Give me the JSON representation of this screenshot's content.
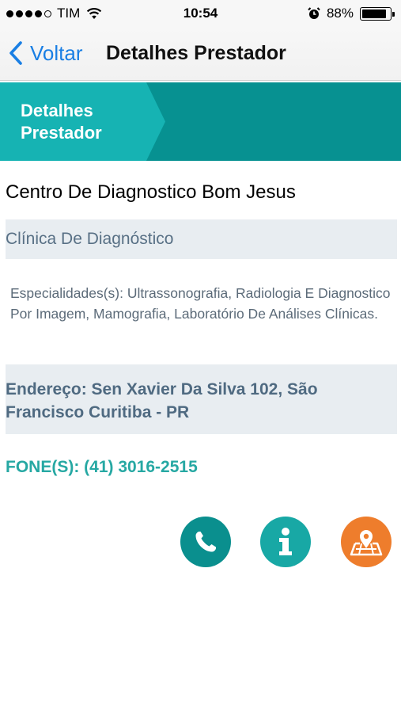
{
  "status_bar": {
    "carrier": "TIM",
    "time": "10:54",
    "battery": "88%",
    "battery_level": 0.88,
    "signal_bars": 4,
    "signal_max": 5
  },
  "nav": {
    "back_label": "Voltar",
    "title": "Detalhes Prestador"
  },
  "breadcrumb": {
    "label": "Detalhes Prestador"
  },
  "provider": {
    "name": "Centro De Diagnostico Bom Jesus",
    "category": "Clínica De Diagnóstico",
    "specialties": "Especialidades(s): Ultrassonografia, Radiologia E Diagnostico Por Imagem, Mamografia, Laboratório De Análises Clínicas.",
    "address": "Endereço: Sen Xavier Da Silva 102, São Francisco Curitiba - PR",
    "phone": "FONE(S): (41) 3016-2515"
  },
  "actions": [
    {
      "name": "call",
      "icon": "phone-icon"
    },
    {
      "name": "info",
      "icon": "info-icon"
    },
    {
      "name": "map",
      "icon": "map-pin-icon"
    }
  ],
  "colors": {
    "teal_dark": "#079191",
    "teal_light": "#16b3b3",
    "accent_blue": "#1a7fe4",
    "orange": "#ee7d2c",
    "phone_text": "#26a8a3",
    "band_bg": "#e8edf1"
  }
}
